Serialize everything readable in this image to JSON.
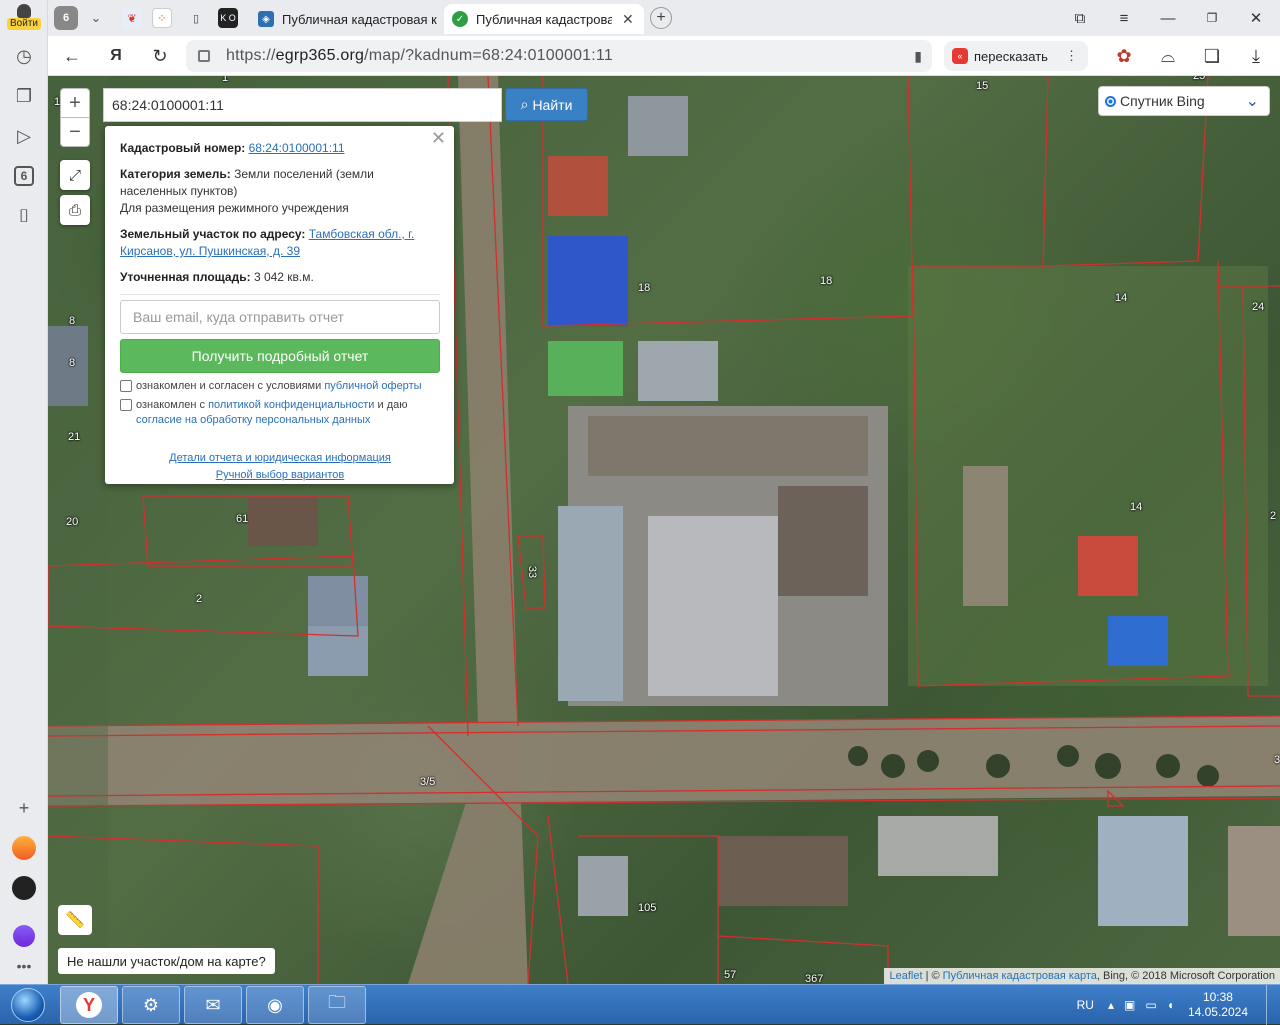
{
  "sidebar": {
    "login_label": "Войти",
    "tab_group_count": "6"
  },
  "tabs": [
    {
      "label": "Публичная кадастровая к",
      "active": false
    },
    {
      "label": "Публичная кадастрова",
      "active": true
    }
  ],
  "pinned_tab_count": "6",
  "pinned_tab_ko": "K O",
  "toolbar": {
    "url_prefix": "https://",
    "url_host": "egrp365.org",
    "url_path": "/map/?kadnum=68:24:0100001:11",
    "retell_label": "пересказать",
    "retell_badge": "«"
  },
  "map": {
    "search_value": "68:24:0100001:11",
    "search_button": "Найти",
    "layer": "Спутник Bing",
    "zoom_in": "+",
    "zoom_out": "−",
    "not_found": "Не нашли участок/дом на карте?",
    "attribution_leaflet": "Leaflet",
    "attribution_sep": " | © ",
    "attribution_source": "Публичная кадастровая карта",
    "attribution_rest": ", Bing, © 2018 Microsoft Corporation",
    "parcel_labels": [
      "1",
      "15",
      "25",
      "18",
      "18",
      "14",
      "24",
      "8",
      "8",
      "21",
      "61",
      "20",
      "2",
      "33",
      "14",
      "2",
      "3/5",
      "105",
      "367",
      "57",
      "3",
      "1"
    ]
  },
  "popup": {
    "cadnum_label": "Кадастровый номер:",
    "cadnum_value": "68:24:0100001:11",
    "category_label": "Категория земель:",
    "category_value": "Земли поселений (земли населенных пунктов)",
    "purpose": "Для размещения режимного учреждения",
    "address_label": "Земельный участок по адресу:",
    "address_value": "Тамбовская обл., г. Кирсанов, ул. Пушкинская, д. 39",
    "area_label": "Уточненная площадь:",
    "area_value": "3 042 кв.м.",
    "email_placeholder": "Ваш email, куда отправить отчет",
    "report_button": "Получить подробный отчет",
    "agree1_text": "ознакомлен и согласен с условиями",
    "agree1_link": "публичной оферты",
    "agree2_text": "ознакомлен с",
    "agree2_link": "политикой конфиденциальности",
    "agree2_text2": "и даю",
    "agree2_link2": "согласие на обработку персональных данных",
    "details_link": "Детали отчета и юридическая информация",
    "manual_link": "Ручной выбор вариантов"
  },
  "taskbar": {
    "lang": "RU",
    "time": "10:38",
    "date": "14.05.2024"
  },
  "colors": {
    "accent": "#3a80c5",
    "report_green": "#5cb85c",
    "parcel_red": "#c62828"
  }
}
